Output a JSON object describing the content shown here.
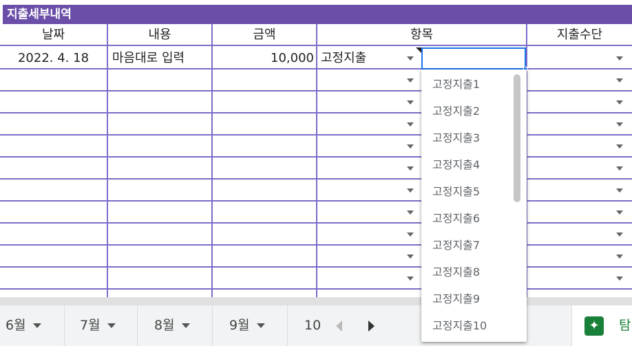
{
  "sheet": {
    "banner_title": "지출세부내역",
    "headers": [
      "날짜",
      "내용",
      "금액",
      "항목",
      "지출수단"
    ],
    "row1": {
      "date": "2022. 4. 18",
      "content": "마음대로 입력",
      "amount": "10,000",
      "category": "고정지출",
      "subcategory": "",
      "method": ""
    }
  },
  "dropdown": {
    "options": [
      "고정지출1",
      "고정지출2",
      "고정지출3",
      "고정지출4",
      "고정지출5",
      "고정지출6",
      "고정지출7",
      "고정지출8",
      "고정지출9",
      "고정지출10"
    ]
  },
  "tabs": {
    "items": [
      "6월",
      "7월",
      "8월",
      "9월",
      "10"
    ],
    "explore_label": "탐",
    "explore_icon": "explore-sparkle-icon"
  },
  "colors": {
    "banner": "#6a4ea8",
    "grid_lines": "#7d6bc9",
    "selection": "#1a73e8",
    "explore": "#188038"
  }
}
